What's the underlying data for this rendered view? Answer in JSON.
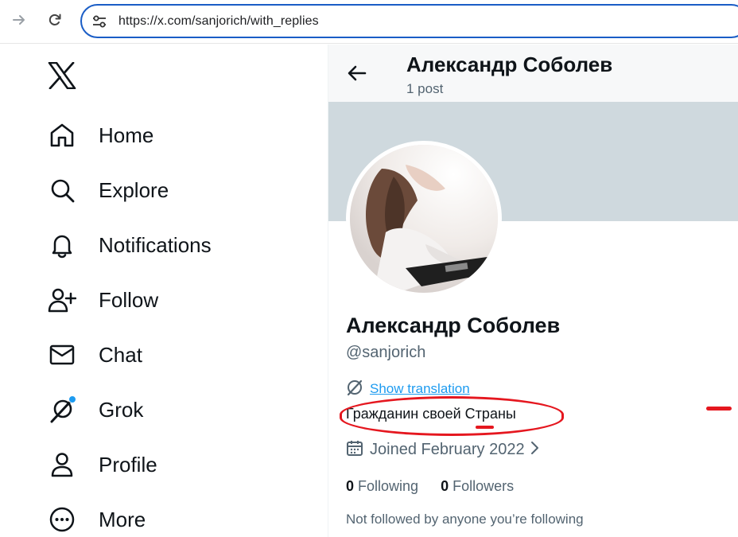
{
  "browser": {
    "url": "https://x.com/sanjorich/with_replies"
  },
  "nav": {
    "items": [
      {
        "label": "Home",
        "icon": "home-icon"
      },
      {
        "label": "Explore",
        "icon": "search-icon"
      },
      {
        "label": "Notifications",
        "icon": "bell-icon"
      },
      {
        "label": "Follow",
        "icon": "follow-user-icon"
      },
      {
        "label": "Chat",
        "icon": "mail-icon"
      },
      {
        "label": "Grok",
        "icon": "grok-icon"
      },
      {
        "label": "Profile",
        "icon": "person-icon"
      },
      {
        "label": "More",
        "icon": "more-circle-icon"
      }
    ]
  },
  "profile": {
    "header_name": "Александр Соболев",
    "header_posts": "1 post",
    "display_name": "Александр Соболев",
    "handle": "@sanjorich",
    "translate_label": "Show translation",
    "bio": "Гражданин своей Страны",
    "joined": "Joined February 2022",
    "following_count": "0",
    "following_label": "Following",
    "followers_count": "0",
    "followers_label": "Followers",
    "followed_by": "Not followed by anyone you’re following"
  },
  "colors": {
    "accent": "#1d9bf0",
    "url_focus": "#1a5dc6",
    "annotation": "#e5171f",
    "banner": "#cfd9de",
    "secondary_text": "#536471"
  }
}
